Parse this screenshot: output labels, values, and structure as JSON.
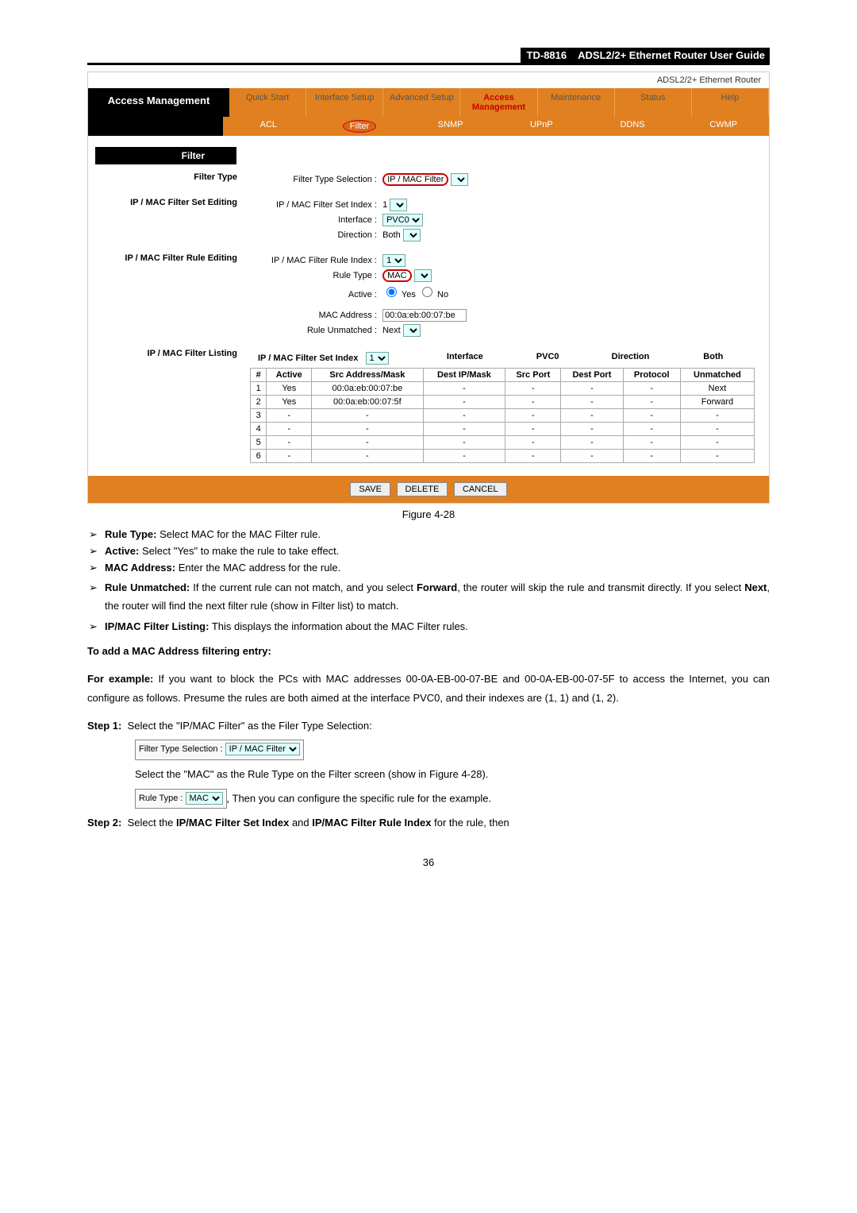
{
  "header": {
    "model": "TD-8816",
    "title": "ADSL2/2+  Ethernet  Router  User  Guide"
  },
  "router_label": "ADSL2/2+ Ethernet Router",
  "lefttab": "Access Management",
  "tabs": [
    "Quick Start",
    "Interface Setup",
    "Advanced Setup",
    "Access Management",
    "Maintenance",
    "Status",
    "Help"
  ],
  "active_tab": "Access Management",
  "subtabs": [
    "ACL",
    "Filter",
    "SNMP",
    "UPnP",
    "DDNS",
    "CWMP"
  ],
  "active_subtab": "Filter",
  "sections": {
    "filter": "Filter",
    "filter_type": "Filter Type",
    "set_editing": "IP / MAC Filter Set Editing",
    "rule_editing": "IP / MAC Filter Rule Editing",
    "listing": "IP / MAC Filter Listing"
  },
  "form": {
    "filter_type_label": "Filter Type Selection :",
    "filter_type_value": "IP / MAC Filter",
    "set_index_label": "IP / MAC Filter Set Index :",
    "set_index_value": "1",
    "interface_label": "Interface :",
    "interface_value": "PVC0",
    "direction_label": "Direction :",
    "direction_value": "Both",
    "rule_index_label": "IP / MAC Filter Rule Index :",
    "rule_index_value": "1",
    "rule_type_label": "Rule Type :",
    "rule_type_value": "MAC",
    "active_label": "Active :",
    "active_yes": "Yes",
    "active_no": "No",
    "mac_label": "MAC Address :",
    "mac_value": "00:0a:eb:00:07:be",
    "unmatched_label": "Rule Unmatched :",
    "unmatched_value": "Next"
  },
  "listing": {
    "header_setindex": "IP / MAC Filter Set Index",
    "header_setindex_val": "1",
    "header_interface": "Interface",
    "header_interface_val": "PVC0",
    "header_direction": "Direction",
    "header_direction_val": "Both",
    "cols": [
      "#",
      "Active",
      "Src Address/Mask",
      "Dest IP/Mask",
      "Src Port",
      "Dest Port",
      "Protocol",
      "Unmatched"
    ],
    "rows": [
      [
        "1",
        "Yes",
        "00:0a:eb:00:07:be",
        "-",
        "-",
        "-",
        "-",
        "Next"
      ],
      [
        "2",
        "Yes",
        "00:0a:eb:00:07:5f",
        "-",
        "-",
        "-",
        "-",
        "Forward"
      ],
      [
        "3",
        "-",
        "-",
        "-",
        "-",
        "-",
        "-",
        "-"
      ],
      [
        "4",
        "-",
        "-",
        "-",
        "-",
        "-",
        "-",
        "-"
      ],
      [
        "5",
        "-",
        "-",
        "-",
        "-",
        "-",
        "-",
        "-"
      ],
      [
        "6",
        "-",
        "-",
        "-",
        "-",
        "-",
        "-",
        "-"
      ]
    ]
  },
  "buttons": {
    "save": "SAVE",
    "delete": "DELETE",
    "cancel": "CANCEL"
  },
  "figure_caption": "Figure 4-28",
  "bullets": [
    {
      "b": "Rule Type:",
      "t": " Select MAC for the MAC Filter rule."
    },
    {
      "b": "Active:",
      "t": " Select \"Yes\" to make the rule to take effect."
    },
    {
      "b": "MAC Address:",
      "t": " Enter the MAC address for the rule."
    },
    {
      "b": "Rule Unmatched:",
      "t": " If the current rule can not match, and you select Forward, the router will skip the rule and transmit directly. If you select Next, the router will find the next filter rule (show in Filter list) to match.",
      "b2": "Forward",
      "b3": "Next"
    },
    {
      "b": "IP/MAC Filter Listing:",
      "t": " This displays the information about the MAC Filter rules."
    }
  ],
  "subhead": "To add a MAC Address filtering entry:",
  "example": "For example: If you want to block the PCs with MAC addresses 00-0A-EB-00-07-BE and 00-0A-EB-00-07-5F to access the Internet, you can configure as follows. Presume the rules are both aimed at the interface PVC0, and their indexes are (1, 1) and (1, 2).",
  "step1_label": "Step 1:",
  "step1_text_a": "Select the \"IP/MAC Filter\" as the Filer Type Selection:",
  "step1_box_label": "Filter Type Selection :",
  "step1_box_value": "IP / MAC Filter",
  "step1_text_b": "Select the \"MAC\" as the Rule Type on the Filter screen (show in Figure 4-28).",
  "step1_box2_label": "Rule Type :",
  "step1_box2_value": "MAC",
  "step1_text_c": ", Then you can configure the specific rule for the example.",
  "step2_label": "Step 2:",
  "step2_text": "Select the IP/MAC Filter Set Index and IP/MAC Filter Rule Index for the rule, then",
  "step2_b1": "IP/MAC Filter Set Index",
  "step2_b2": "IP/MAC Filter Rule Index",
  "pagenum": "36"
}
